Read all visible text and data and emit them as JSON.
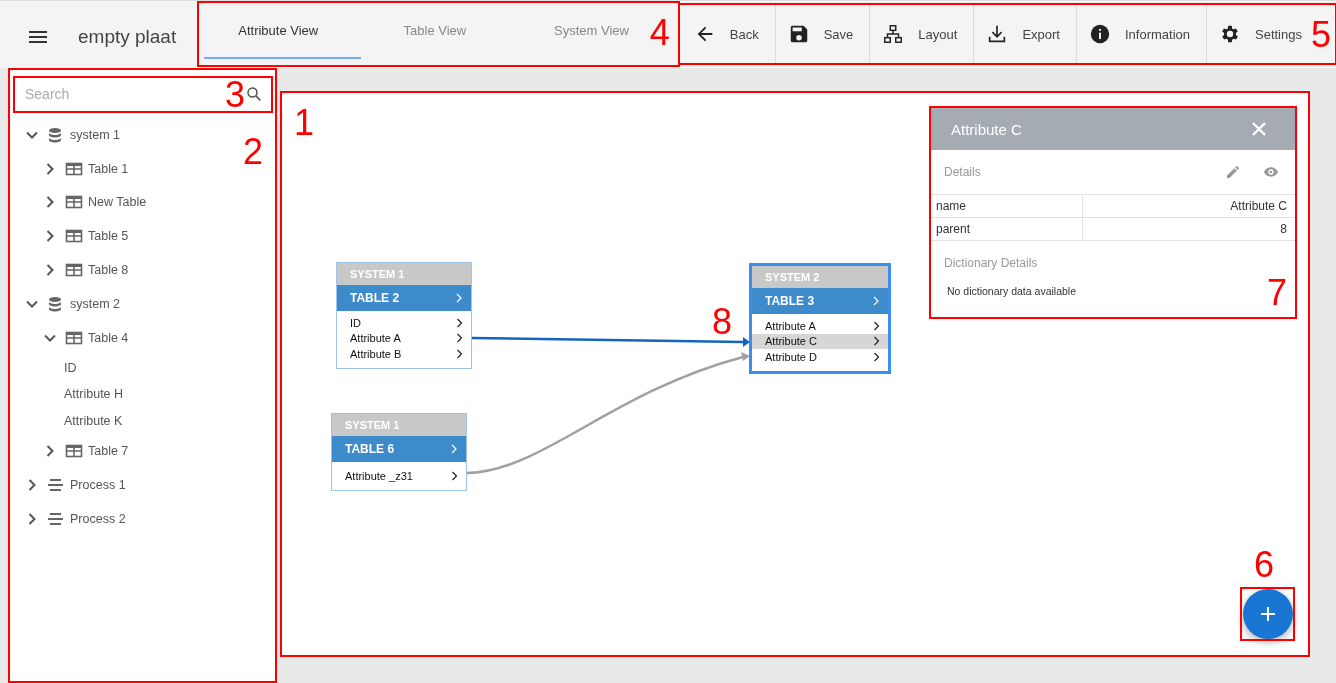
{
  "header": {
    "title": "empty plaat"
  },
  "view_tabs": {
    "annotation": "4",
    "tabs": [
      {
        "label": "Attribute View",
        "selected": true
      },
      {
        "label": "Table View",
        "selected": false
      },
      {
        "label": "System View",
        "selected": false
      }
    ]
  },
  "toolbar": {
    "annotation": "5",
    "buttons": [
      {
        "label": "Back",
        "kind": "back"
      },
      {
        "label": "Save",
        "kind": "save"
      },
      {
        "label": "Layout",
        "kind": "layout"
      },
      {
        "label": "Export",
        "kind": "export"
      },
      {
        "label": "Information",
        "kind": "info"
      },
      {
        "label": "Settings",
        "kind": "settings"
      }
    ]
  },
  "sidebar": {
    "annotation": "2",
    "search": {
      "placeholder": "Search",
      "annotation": "3"
    },
    "tree": [
      {
        "label": "system 1",
        "kind": "system",
        "expanded": true,
        "children": [
          {
            "label": "Table 1",
            "kind": "table",
            "expanded": false
          },
          {
            "label": "New Table",
            "kind": "table",
            "expanded": false
          },
          {
            "label": "Table 5",
            "kind": "table",
            "expanded": false
          },
          {
            "label": "Table 8",
            "kind": "table",
            "expanded": false
          }
        ]
      },
      {
        "label": "system 2",
        "kind": "system",
        "expanded": true,
        "children": [
          {
            "label": "Table 4",
            "kind": "table",
            "expanded": true,
            "children": [
              {
                "label": "ID",
                "kind": "attribute"
              },
              {
                "label": "Attribute H",
                "kind": "attribute"
              },
              {
                "label": "Attribute K",
                "kind": "attribute"
              }
            ]
          },
          {
            "label": "Table 7",
            "kind": "table",
            "expanded": false
          }
        ]
      },
      {
        "label": "Process 1",
        "kind": "process",
        "expanded": false
      },
      {
        "label": "Process 2",
        "kind": "process",
        "expanded": false
      }
    ]
  },
  "canvas": {
    "annotation": "1",
    "nodes": [
      {
        "system": "SYSTEM 1",
        "table": "TABLE 2",
        "selected": false,
        "attributes": [
          {
            "name": "ID",
            "selected": false
          },
          {
            "name": "Attribute A",
            "selected": false
          },
          {
            "name": "Attribute B",
            "selected": false
          }
        ]
      },
      {
        "system": "SYSTEM 1",
        "table": "TABLE 6",
        "selected": false,
        "attributes": [
          {
            "name": "Attribute _z31",
            "selected": false
          }
        ]
      },
      {
        "system": "SYSTEM 2",
        "table": "TABLE 3",
        "selected": true,
        "attributes": [
          {
            "name": "Attribute A",
            "selected": false
          },
          {
            "name": "Attribute C",
            "selected": true
          },
          {
            "name": "Attribute D",
            "selected": false
          }
        ]
      }
    ],
    "edges": [
      {
        "highlighted": true,
        "annotation": "8"
      },
      {
        "highlighted": false
      }
    ],
    "details": {
      "annotation": "7",
      "title": "Attribute C",
      "section": "Details",
      "properties": [
        {
          "key": "name",
          "value": "Attribute C"
        },
        {
          "key": "parent",
          "value": "8"
        }
      ],
      "dictionary_title": "Dictionary Details",
      "dictionary_message": "No dictionary data available"
    },
    "add_button": {
      "annotation": "6"
    }
  }
}
